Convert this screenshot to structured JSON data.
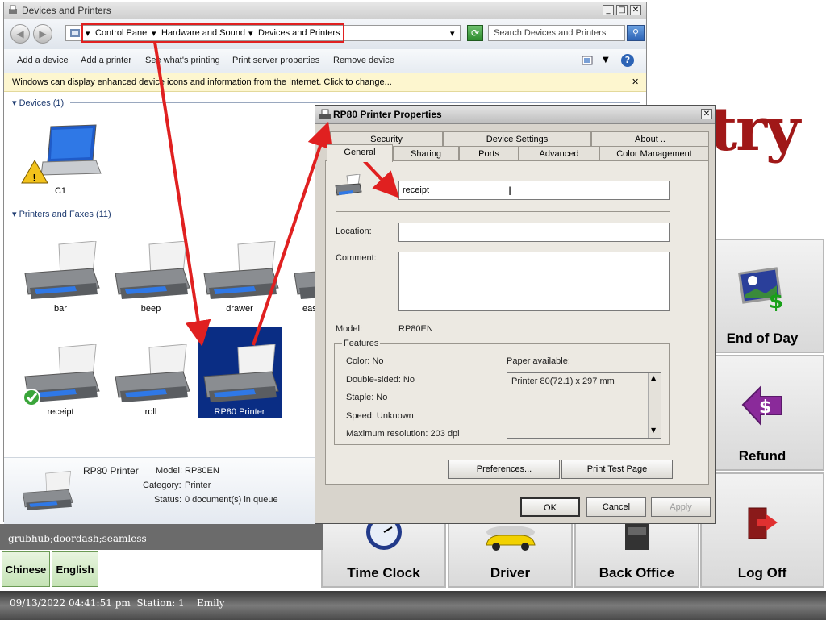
{
  "explorer": {
    "title": "Devices and Printers",
    "breadcrumbs": [
      "Control Panel",
      "Hardware and Sound",
      "Devices and Printers"
    ],
    "search_placeholder": "Search Devices and Printers",
    "toolbar": [
      "Add a device",
      "Add a printer",
      "See what's printing",
      "Print server properties",
      "Remove device"
    ],
    "infobar_text": "Windows can display enhanced device icons and information from the Internet. Click to change...",
    "devices_header": "Devices (1)",
    "devices": [
      {
        "name": "C1"
      }
    ],
    "printers_header": "Printers and Faxes (11)",
    "printers": [
      {
        "name": "bar"
      },
      {
        "name": "beep"
      },
      {
        "name": "drawer"
      },
      {
        "name": "eas"
      },
      {
        "name": "receipt"
      },
      {
        "name": "roll"
      },
      {
        "name": "RP80 Printer"
      }
    ],
    "details": {
      "name": "RP80 Printer",
      "model_label": "Model:",
      "model_value": "RP80EN",
      "category_label": "Category:",
      "category_value": "Printer",
      "status_label": "Status:",
      "status_value": "0 document(s) in queue"
    }
  },
  "dialog": {
    "title": "RP80 Printer Properties",
    "tabs_top": [
      "Security",
      "Device Settings",
      "About .."
    ],
    "tabs_bottom": [
      "General",
      "Sharing",
      "Ports",
      "Advanced",
      "Color Management"
    ],
    "printer_name": "receipt",
    "location_label": "Location:",
    "location_value": "",
    "comment_label": "Comment:",
    "comment_value": "",
    "model_label": "Model:",
    "model_value": "RP80EN",
    "features_label": "Features",
    "features": [
      "Color: No",
      "Double-sided: No",
      "Staple: No",
      "Speed: Unknown",
      "Maximum resolution: 203 dpi"
    ],
    "paper_label": "Paper available:",
    "paper_items": [
      "Printer 80(72.1) x 297 mm"
    ],
    "preferences_button": "Preferences...",
    "print_test_button": "Print Test Page",
    "ok_button": "OK",
    "cancel_button": "Cancel",
    "apply_button": "Apply"
  },
  "pos": {
    "brand_fragment_gray": "try",
    "brand_fragment_red": "",
    "buttons": [
      "End of Day",
      "Refund",
      "Time Clock",
      "Driver",
      "Back Office",
      "Log Off"
    ],
    "note": "grubhub;doordash;seamless",
    "lang_buttons": [
      "Chinese",
      "English"
    ],
    "status": "09/13/2022 04:41:51 pm  Station: 1    Emily"
  },
  "colors": {
    "annotation": "#e02020",
    "selection": "#0a2d84",
    "accent_green": "#3aa53a"
  }
}
